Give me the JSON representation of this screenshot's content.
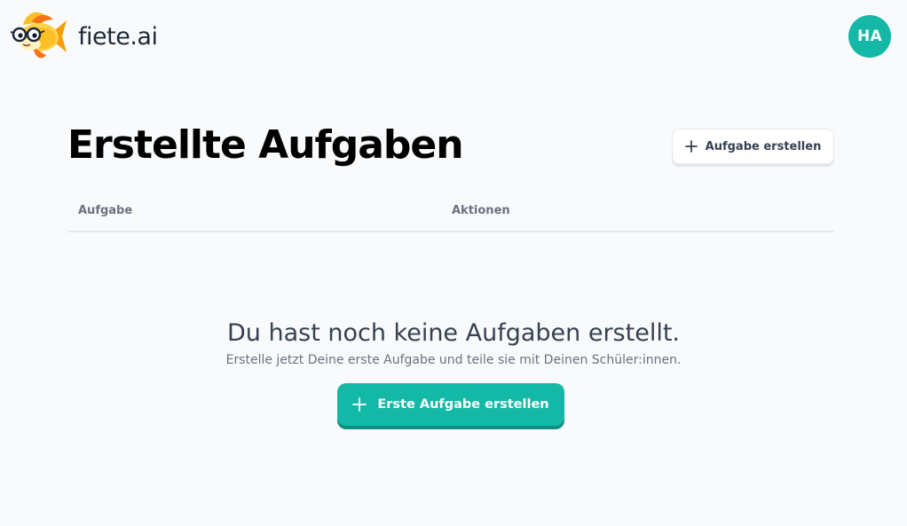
{
  "header": {
    "brand": "fiete.ai",
    "avatar_initials": "HA"
  },
  "page": {
    "title": "Erstellte Aufgaben",
    "create_button_label": "Aufgabe erstellen"
  },
  "table": {
    "columns": [
      "Aufgabe",
      "Aktionen"
    ],
    "rows": []
  },
  "empty_state": {
    "title": "Du hast noch keine Aufgaben erstellt.",
    "text": "Erstelle jetzt Deine erste Aufgabe und teile sie mit Deinen Schüler:innen.",
    "button_label": "Erste Aufgabe erstellen"
  },
  "colors": {
    "accent": "#14b8a6",
    "background": "#f8fafb"
  },
  "icons": {
    "logo": "fish-with-glasses-logo",
    "add": "plus-icon"
  }
}
